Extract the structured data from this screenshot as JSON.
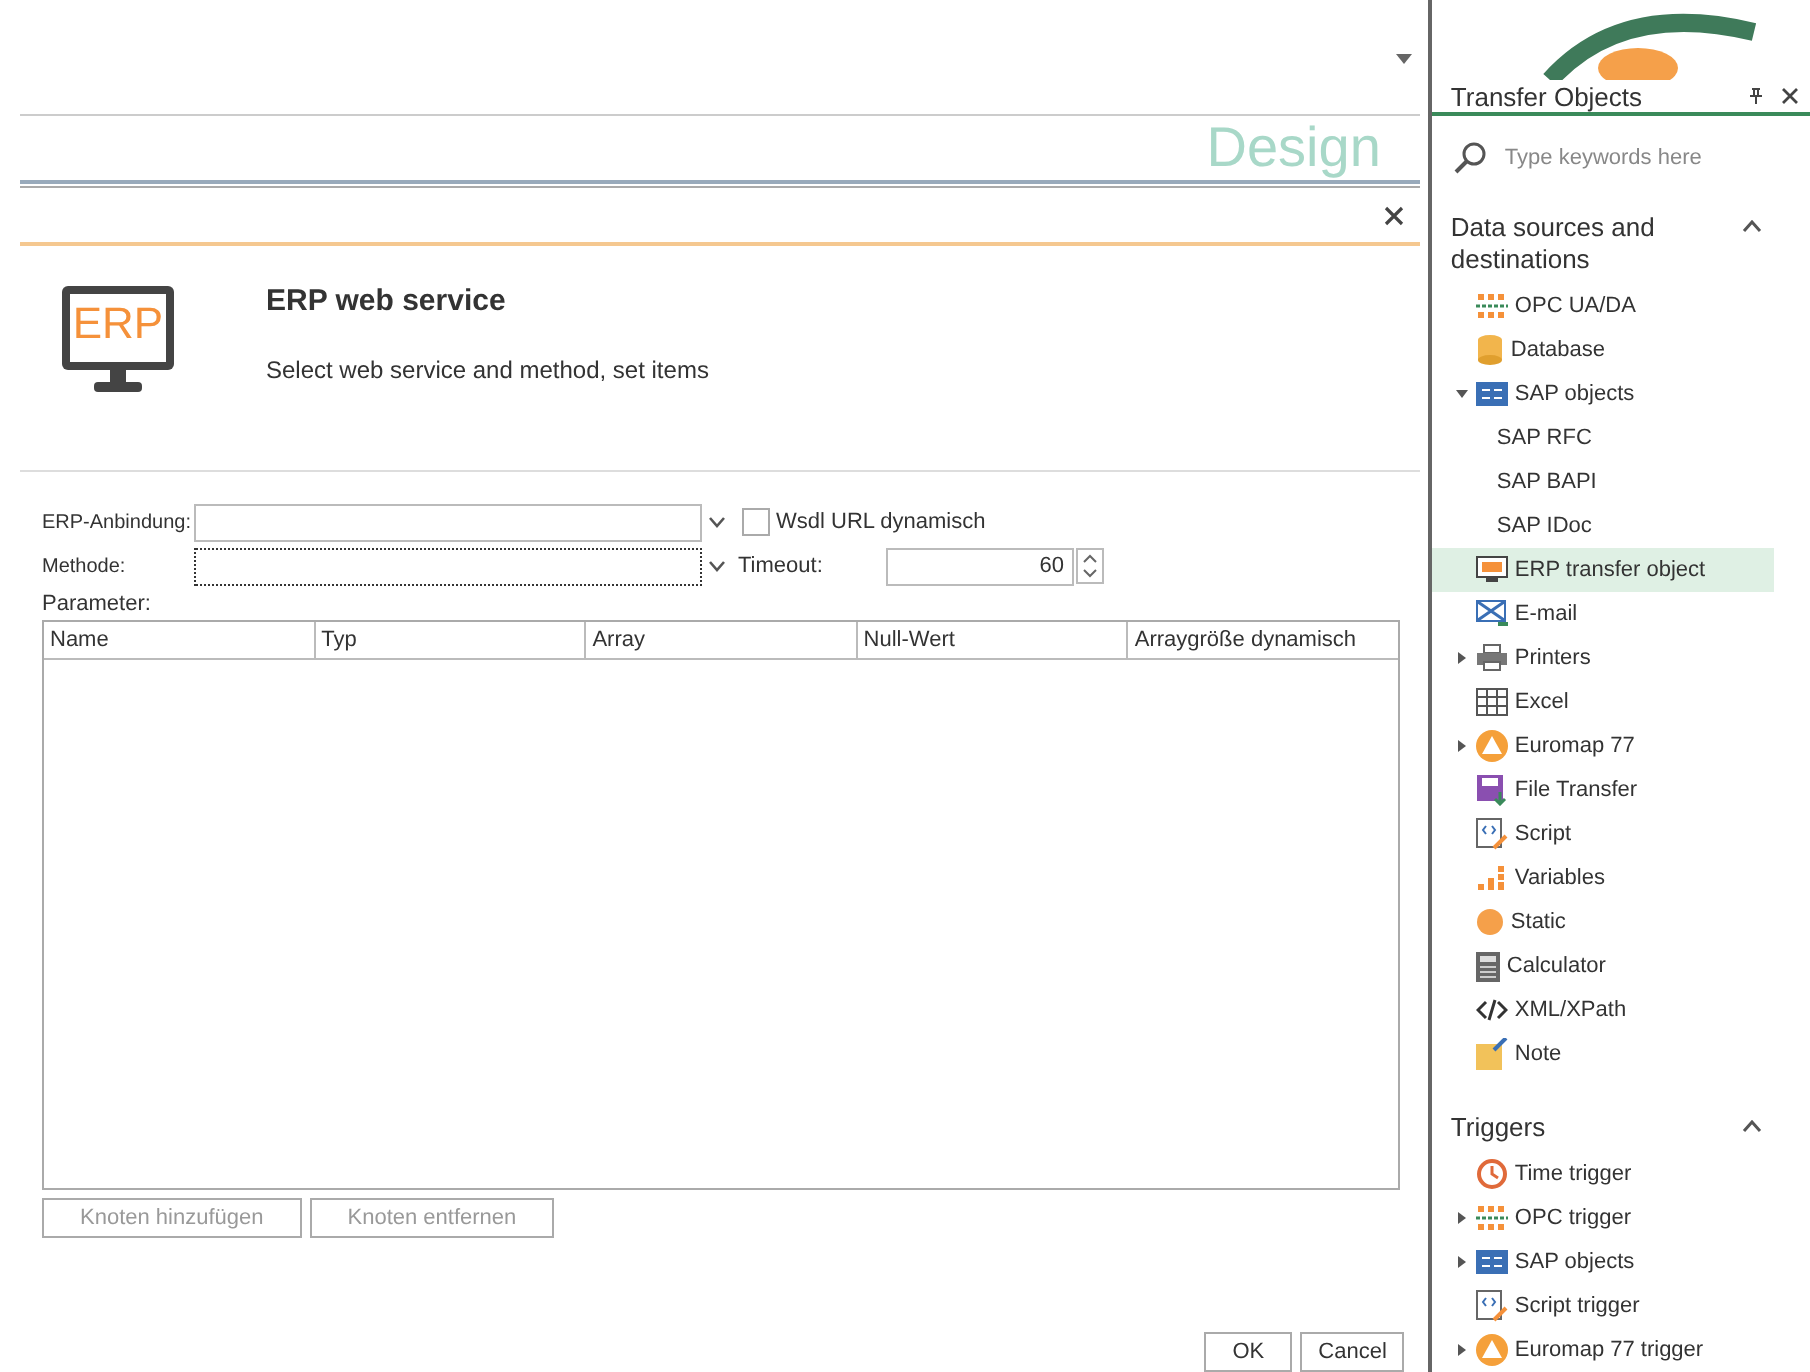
{
  "design_title": "Design",
  "dialog": {
    "title": "ERP web service",
    "subtitle": "Select web service and method, set items",
    "logo_text": "ERP",
    "fields": [
      {
        "label": "ERP-Anbindung:",
        "focused": false,
        "check_label": "Wsdl URL dynamisch",
        "checked": false
      },
      {
        "label": "Methode:",
        "focused": true,
        "side_label": "Timeout:",
        "spin_value": "60"
      }
    ],
    "table_label": "Parameter:",
    "table": {
      "columns": [
        "Name",
        "Typ",
        "Array",
        "Null-Wert",
        "Arraygröße dynamisch"
      ]
    },
    "node_buttons": [
      {
        "label": "Knoten hinzufügen",
        "disabled": true
      },
      {
        "label": "Knoten entfernen",
        "disabled": true
      }
    ],
    "buttons": [
      "OK",
      "Cancel"
    ]
  },
  "panel": {
    "title": "Transfer Objects",
    "search": {
      "placeholder": "Type keywords here"
    },
    "sections": [
      {
        "title": "Data sources and destinations",
        "expanded": true,
        "items": [
          {
            "label": "OPC UA/DA",
            "kind": "opc",
            "selected": false
          },
          {
            "label": "Database",
            "kind": "database",
            "selected": false
          },
          {
            "label": "SAP objects",
            "kind": "sap",
            "selected": false,
            "expanded": true,
            "children": [
              {
                "label": "SAP RFC",
                "selected": false
              },
              {
                "label": "SAP BAPI",
                "selected": false
              },
              {
                "label": "SAP IDoc",
                "selected": false
              }
            ]
          },
          {
            "label": "ERP transfer object",
            "kind": "erp",
            "selected": true
          },
          {
            "label": "E-mail",
            "kind": "email",
            "selected": false
          },
          {
            "label": "Printers",
            "kind": "printer",
            "selected": false,
            "expanded": false
          },
          {
            "label": "Excel",
            "kind": "excel",
            "selected": false
          },
          {
            "label": "Euromap 77",
            "kind": "euromap",
            "selected": false,
            "expanded": false
          },
          {
            "label": "File Transfer",
            "kind": "file",
            "selected": false
          },
          {
            "label": "Script",
            "kind": "script",
            "selected": false
          },
          {
            "label": "Variables",
            "kind": "variables",
            "selected": false
          },
          {
            "label": "Static",
            "kind": "static",
            "selected": false
          },
          {
            "label": "Calculator",
            "kind": "calculator",
            "selected": false
          },
          {
            "label": "XML/XPath",
            "kind": "xml",
            "selected": false
          },
          {
            "label": "Note",
            "kind": "note",
            "selected": false
          }
        ]
      },
      {
        "title": "Triggers",
        "expanded": true,
        "items": [
          {
            "label": "Time trigger",
            "kind": "time",
            "selected": false
          },
          {
            "label": "OPC trigger",
            "kind": "opc",
            "selected": false,
            "expanded": false
          },
          {
            "label": "SAP objects",
            "kind": "sap",
            "selected": false,
            "expanded": false
          },
          {
            "label": "Script trigger",
            "kind": "script",
            "selected": false
          },
          {
            "label": "Euromap 77 trigger",
            "kind": "euromap",
            "selected": false,
            "expanded": false
          }
        ]
      }
    ]
  }
}
